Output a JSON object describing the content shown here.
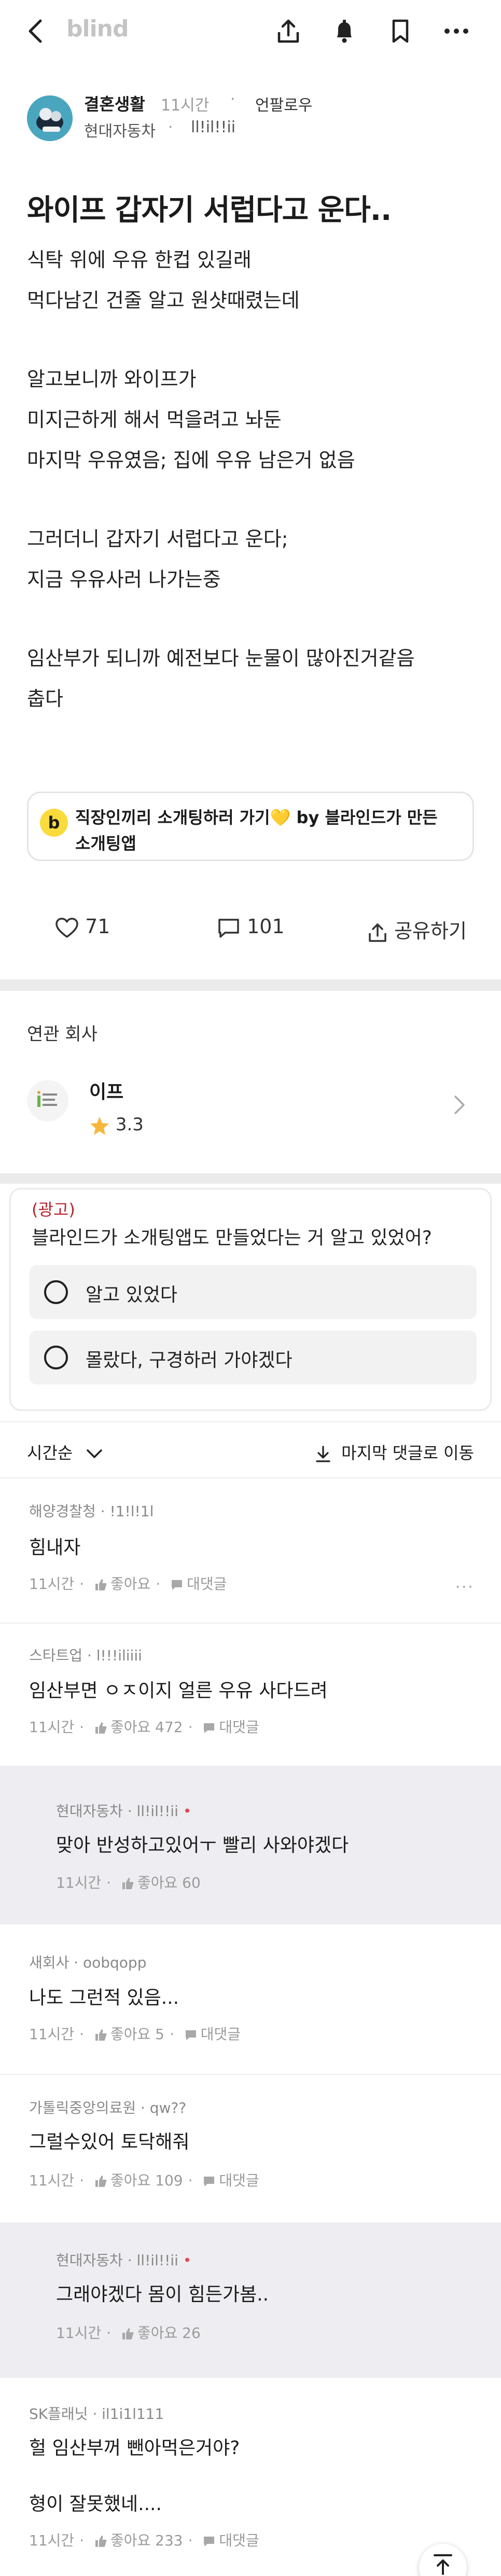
{
  "header": {
    "logo": "blind"
  },
  "post": {
    "board": "결혼생활",
    "time": "11시간",
    "dot": "·",
    "follow": "언팔로우",
    "company": "현대자동차",
    "nick": "ll!il!!ii",
    "title": "와이프 갑자기 서럽다고 운다..",
    "body": [
      "식탁 위에 우유 한컵 있길래",
      "먹다남긴 건줄 알고 원샷때렸는데",
      "",
      "알고보니까 와이프가",
      "미지근하게 해서 먹을려고 놔둔",
      "마지막 우유였음; 집에 우유 남은거 없음",
      "",
      "그러더니 갑자기 서럽다고 운다;",
      "지금 우유사러 나가는중",
      "",
      "임산부가 되니까 예전보다 눈물이 많아진거같음",
      "춥다"
    ]
  },
  "banner": {
    "icon_letter": "b",
    "line1": "직장인끼리 소개팅하러 가기💛 by 블라인드가 만든",
    "line2": "소개팅앱"
  },
  "actions": {
    "likes": "71",
    "comments": "101",
    "share": "공유하기"
  },
  "related": {
    "title": "연관 회사",
    "company": "이프",
    "rating": "3.3"
  },
  "ad": {
    "tag": "(광고)",
    "question": "블라인드가 소개팅앱도 만들었다는 거 알고 있었어?",
    "option1": "알고 있었다",
    "option2": "몰랐다, 구경하러 가야겠다"
  },
  "sort": {
    "label": "시간순",
    "last": "마지막 댓글로 이동"
  },
  "comments": [
    {
      "company": "해양경찰청",
      "nick": "!1!l!1l",
      "text": "힘내자",
      "time": "11시간",
      "like": "좋아요",
      "reply": "대댓글"
    },
    {
      "company": "스타트업",
      "nick": "l!!!iliiii",
      "text": "임산부면 ㅇㅈ이지 얼른 우유 사다드려",
      "time": "11시간",
      "like": "좋아요 472",
      "reply": "대댓글"
    },
    {
      "company": "현대자동차",
      "nick": "ll!il!!ii",
      "text": "맞아 반성하고있어ㅜ 빨리 사와야겠다",
      "time": "11시간",
      "like": "좋아요 60"
    },
    {
      "company": "새회사",
      "nick": "oobqopp",
      "text": "나도 그런적 있음...",
      "time": "11시간",
      "like": "좋아요 5",
      "reply": "대댓글"
    },
    {
      "company": "가톨릭중앙의료원",
      "nick": "qw??",
      "text": "그럴수있어 토닥해줘",
      "time": "11시간",
      "like": "좋아요 109",
      "reply": "대댓글"
    },
    {
      "company": "현대자동차",
      "nick": "ll!il!!ii",
      "text": "그래야겠다 몸이 힘든가봄..",
      "time": "11시간",
      "like": "좋아요 26"
    },
    {
      "company": "SK플래닛",
      "nick": "il1i1l111",
      "text": "헐 임산부꺼 뺀아먹은거야?",
      "text2": "형이 잘못했네....",
      "time": "11시간",
      "like": "좋아요 233",
      "reply": "대댓글"
    }
  ]
}
